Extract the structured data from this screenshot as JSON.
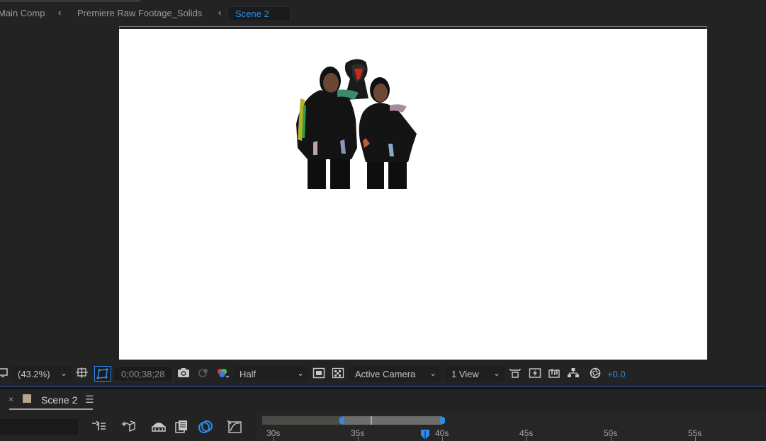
{
  "breadcrumbs": {
    "items": [
      "Main Comp",
      "Premiere Raw Footage_Solids"
    ],
    "active": "Scene 2"
  },
  "viewer": {
    "canvas_color": "#ffffff",
    "content": "people-image"
  },
  "viewer_toolbar": {
    "magnification": "(43.2%)",
    "timecode": "0;00;38;28",
    "resolution": "Half",
    "camera": "Active Camera",
    "views": "1 View",
    "exposure": "+0.0"
  },
  "timeline": {
    "tab_label": "Scene 2",
    "close_glyph": "×",
    "menu_glyph": "☰",
    "label_color": "#b5a78a",
    "search_value": "",
    "ruler_labels": [
      "30s",
      "35s",
      "40s",
      "45s",
      "50s",
      "55s"
    ],
    "playhead_time": "0;00;38;28"
  },
  "colors": {
    "accent": "#2d8ceb",
    "panel_bg": "#232323"
  }
}
